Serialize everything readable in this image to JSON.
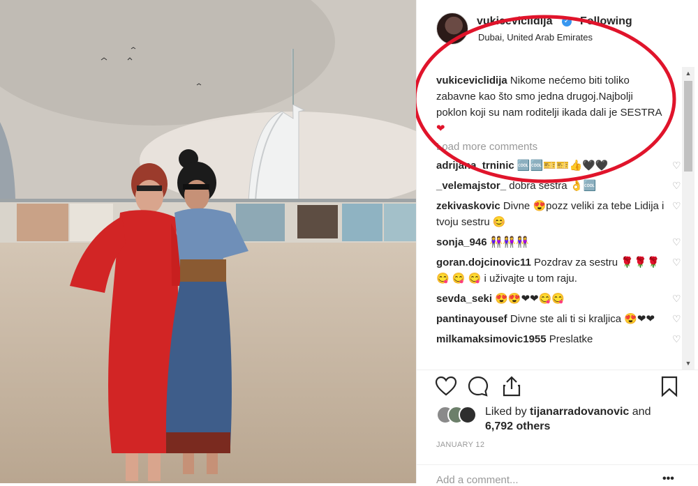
{
  "post": {
    "username": "vukiceviclidija",
    "follow_status": "Following",
    "location": "Dubai, United Arab Emirates",
    "caption_user": "vukiceviclidija",
    "caption_text": "Nikome nećemo biti toliko zabavne kao što smo jedna drugoj.Najbolji poklon koji su nam roditelji ikada dali je SESTRA",
    "caption_emoji": "❤",
    "load_more": "Load more comments",
    "likes_prefix": "Liked by ",
    "likes_user": "tijanarradovanovic",
    "likes_suffix": " and",
    "likes_others": "6,792 others",
    "date": "JANUARY 12",
    "add_comment_placeholder": "Add a comment...",
    "more_options": "•••"
  },
  "comments": [
    {
      "user": "adrijana_trninic",
      "text": "🆒🆒🎫🎫👍🖤🖤"
    },
    {
      "user": "_velemajstor_",
      "text": "dobra sestra 👌🆒"
    },
    {
      "user": "zekivaskovic",
      "text": "Divne 😍pozz veliki za tebe Lidija i tvoju sestru 😊"
    },
    {
      "user": "sonja_946",
      "text": "👭👭👭"
    },
    {
      "user": "goran.dojcinovic11",
      "text": "Pozdrav za sestru 🌹🌹🌹 😋 😋 😋 i uživajte u tom raju."
    },
    {
      "user": "sevda_seki",
      "text": "😍😍❤❤😋😋"
    },
    {
      "user": "pantinayousef",
      "text": "Divne ste ali ti si kraljica 😍❤❤"
    },
    {
      "user": "milkamaksimovic1955",
      "text": "Preslatke"
    }
  ],
  "icons": {
    "verified": "verified-badge-icon",
    "like": "heart-outline-icon",
    "comment": "speech-bubble-icon",
    "share": "share-icon",
    "save": "bookmark-icon"
  },
  "colors": {
    "accent": "#3897f0",
    "annotation": "#e0142b"
  }
}
